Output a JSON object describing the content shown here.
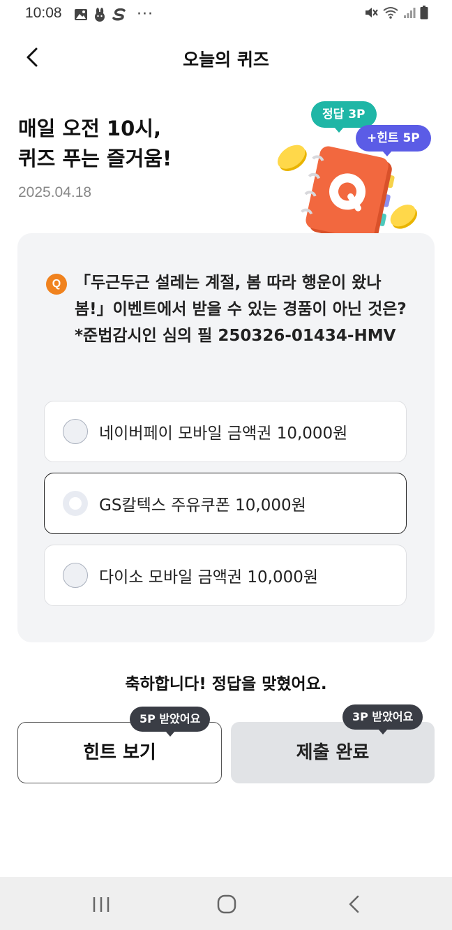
{
  "status_bar": {
    "time": "10:08",
    "dots": "···"
  },
  "header": {
    "title": "오늘의 퀴즈"
  },
  "intro": {
    "headline_line1": "매일 오전 10시,",
    "headline_line2": "퀴즈 푸는 즐거움!",
    "date": "2025.04.18"
  },
  "reward_tags": {
    "answer": "정답 3P",
    "hint": "+힌트 5P"
  },
  "illustration": {
    "letter": "Q"
  },
  "quiz": {
    "badge": "Q",
    "question": "「두근두근 설레는 계절, 봄 따라 행운이 왔나 봄!」이벤트에서 받을 수 있는 경품이 아닌 것은? *준법감시인 심의 필 250326-01434-HMV",
    "options": [
      {
        "label": "네이버페이 모바일 금액권 10,000원",
        "selected": false
      },
      {
        "label": "GS칼텍스 주유쿠폰 10,000원",
        "selected": true
      },
      {
        "label": "다이소 모바일 금액권 10,000원",
        "selected": false
      }
    ]
  },
  "result": {
    "message": "축하합니다! 정답을 맞혔어요."
  },
  "actions": {
    "hint_label": "힌트 보기",
    "hint_bubble": "5P 받았어요",
    "submit_label": "제출 완료",
    "submit_bubble": "3P 받았어요"
  },
  "colors": {
    "answer_tag": "#1fb6a6",
    "hint_tag": "#5b5ce6",
    "q_badge": "#f0821e",
    "notebook": "#f2683f",
    "bubble": "#3a3d45"
  }
}
